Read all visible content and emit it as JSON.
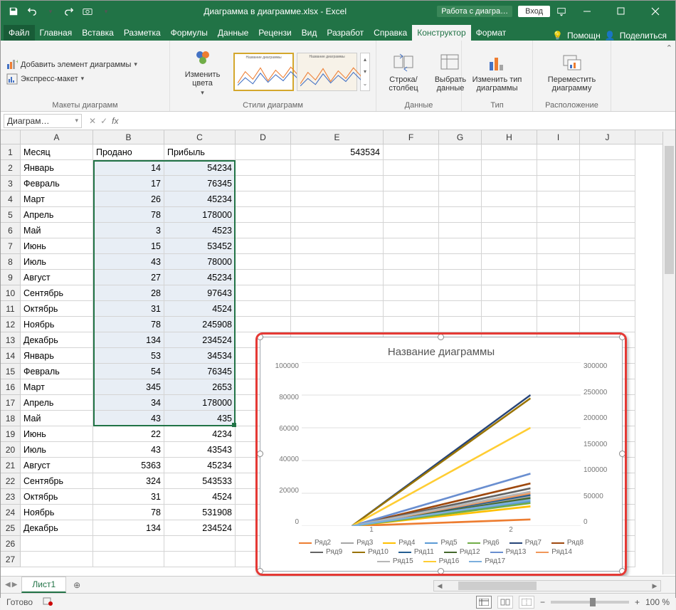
{
  "title": "Диаграмма в диаграмме.xlsx - Excel",
  "contextual_tab_title": "Работа с диагра…",
  "login_button": "Вход",
  "tabs": {
    "file": "Файл",
    "home": "Главная",
    "insert": "Вставка",
    "layout": "Разметка",
    "formulas": "Формулы",
    "data": "Данные",
    "review": "Рецензи",
    "view": "Вид",
    "developer": "Разработ",
    "help": "Справка",
    "design": "Конструктор",
    "format": "Формат",
    "tell_me": "Помощн",
    "share": "Поделиться"
  },
  "ribbon": {
    "group_layouts": "Макеты диаграмм",
    "add_element": "Добавить элемент диаграммы",
    "quick_layout": "Экспресс-макет",
    "group_styles": "Стили диаграмм",
    "change_colors": "Изменить цвета",
    "group_data": "Данные",
    "switch_rowcol": "Строка/ столбец",
    "select_data": "Выбрать данные",
    "group_type": "Тип",
    "change_type": "Изменить тип диаграммы",
    "group_location": "Расположение",
    "move_chart": "Переместить диаграмму"
  },
  "namebox": "Диаграм…",
  "columns": [
    "A",
    "B",
    "C",
    "D",
    "E",
    "F",
    "G",
    "H",
    "I",
    "J"
  ],
  "headers": {
    "A": "Месяц",
    "B": "Продано",
    "C": "Прибыль"
  },
  "E1": "543534",
  "rows": [
    {
      "n": 1
    },
    {
      "n": 2,
      "a": "Январь",
      "b": 14,
      "c": 54234
    },
    {
      "n": 3,
      "a": "Февраль",
      "b": 17,
      "c": 76345
    },
    {
      "n": 4,
      "a": "Март",
      "b": 26,
      "c": 45234
    },
    {
      "n": 5,
      "a": "Апрель",
      "b": 78,
      "c": 178000
    },
    {
      "n": 6,
      "a": "Май",
      "b": 3,
      "c": 4523
    },
    {
      "n": 7,
      "a": "Июнь",
      "b": 15,
      "c": 53452
    },
    {
      "n": 8,
      "a": "Июль",
      "b": 43,
      "c": 78000
    },
    {
      "n": 9,
      "a": "Август",
      "b": 27,
      "c": 45234
    },
    {
      "n": 10,
      "a": "Сентябрь",
      "b": 28,
      "c": 97643
    },
    {
      "n": 11,
      "a": "Октябрь",
      "b": 31,
      "c": 4524
    },
    {
      "n": 12,
      "a": "Ноябрь",
      "b": 78,
      "c": 245908
    },
    {
      "n": 13,
      "a": "Декабрь",
      "b": 134,
      "c": 234524
    },
    {
      "n": 14,
      "a": "Январь",
      "b": 53,
      "c": 34534
    },
    {
      "n": 15,
      "a": "Февраль",
      "b": 54,
      "c": 76345
    },
    {
      "n": 16,
      "a": "Март",
      "b": 345,
      "c": 2653
    },
    {
      "n": 17,
      "a": "Апрель",
      "b": 34,
      "c": 178000
    },
    {
      "n": 18,
      "a": "Май",
      "b": 43,
      "c": 435
    },
    {
      "n": 19,
      "a": "Июнь",
      "b": 22,
      "c": 4234
    },
    {
      "n": 20,
      "a": "Июль",
      "b": 43,
      "c": 43543
    },
    {
      "n": 21,
      "a": "Август",
      "b": 5363,
      "c": 45234
    },
    {
      "n": 22,
      "a": "Сентябрь",
      "b": 324,
      "c": 543533
    },
    {
      "n": 23,
      "a": "Октябрь",
      "b": 31,
      "c": 4524
    },
    {
      "n": 24,
      "a": "Ноябрь",
      "b": 78,
      "c": 531908
    },
    {
      "n": 25,
      "a": "Декабрь",
      "b": 134,
      "c": 234524
    }
  ],
  "chart_data": {
    "type": "line",
    "title": "Название диаграммы",
    "x": [
      1,
      2
    ],
    "xlabel": "",
    "ylabel": "",
    "y_left": {
      "ticks": [
        0,
        20000,
        40000,
        60000,
        80000,
        100000
      ],
      "lim": [
        0,
        100000
      ]
    },
    "y_right": {
      "ticks": [
        0,
        50000,
        100000,
        150000,
        200000,
        250000,
        300000
      ],
      "lim": [
        0,
        300000
      ]
    },
    "series": [
      {
        "name": "Ряд2",
        "color": "#ed7d31",
        "values": [
          0,
          4000
        ]
      },
      {
        "name": "Ряд3",
        "color": "#a5a5a5",
        "values": [
          0,
          18000
        ]
      },
      {
        "name": "Ряд4",
        "color": "#ffc000",
        "values": [
          0,
          12000
        ]
      },
      {
        "name": "Ряд5",
        "color": "#5b9bd5",
        "values": [
          0,
          15000
        ]
      },
      {
        "name": "Ряд6",
        "color": "#70ad47",
        "values": [
          0,
          14000
        ]
      },
      {
        "name": "Ряд7",
        "color": "#264478",
        "values": [
          0,
          80000
        ]
      },
      {
        "name": "Ряд8",
        "color": "#9e480e",
        "values": [
          0,
          26000
        ]
      },
      {
        "name": "Ряд9",
        "color": "#636363",
        "values": [
          0,
          23000
        ]
      },
      {
        "name": "Ряд10",
        "color": "#997300",
        "values": [
          0,
          78000
        ]
      },
      {
        "name": "Ряд11",
        "color": "#255e91",
        "values": [
          0,
          19000
        ]
      },
      {
        "name": "Ряд12",
        "color": "#43682b",
        "values": [
          0,
          17000
        ]
      },
      {
        "name": "Ряд13",
        "color": "#698ed0",
        "values": [
          0,
          32000
        ]
      },
      {
        "name": "Ряд14",
        "color": "#f1975a",
        "values": [
          0,
          20000
        ]
      },
      {
        "name": "Ряд15",
        "color": "#b7b7b7",
        "values": [
          0,
          21000
        ]
      },
      {
        "name": "Ряд16",
        "color": "#ffcd33",
        "values": [
          0,
          60000
        ]
      },
      {
        "name": "Ряд17",
        "color": "#7cafdd",
        "values": [
          0,
          16000
        ]
      }
    ]
  },
  "sheet_tab": "Лист1",
  "status": "Готово",
  "zoom": "100 %"
}
